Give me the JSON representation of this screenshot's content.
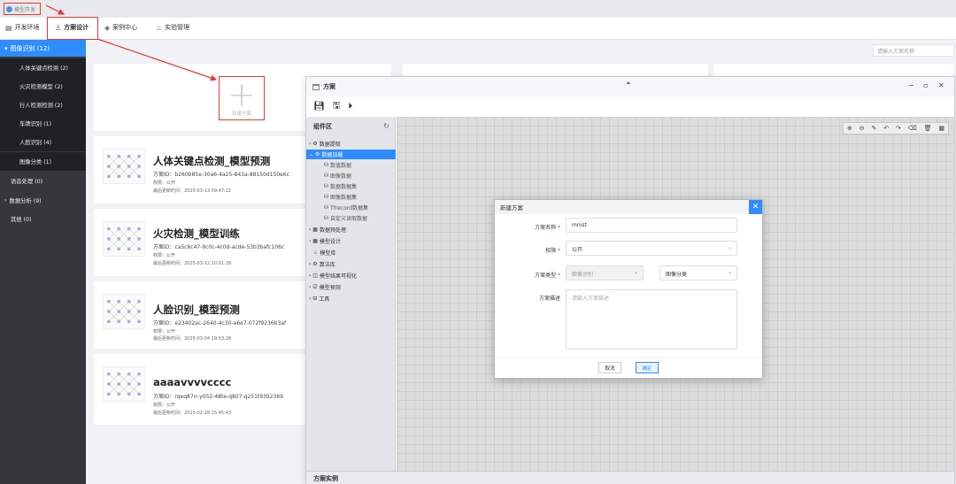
{
  "topbar": {
    "logo_text": "模型开发"
  },
  "nav": {
    "tabs": [
      {
        "label": "开发环境",
        "icon": "server-icon"
      },
      {
        "label": "方案设计",
        "icon": "user-icon",
        "active": true
      },
      {
        "label": "案例中心",
        "icon": "layers-icon"
      },
      {
        "label": "实验管理",
        "icon": "flask-icon"
      }
    ]
  },
  "sidebar": {
    "groups": [
      {
        "label": "图像识别 (12)",
        "expanded": true,
        "children": [
          "人体关键点检测 (2)",
          "火灾检测模型 (2)",
          "行人检测检测 (2)",
          "车牌识别 (1)",
          "人脸识别 (4)",
          "图像分类 (1)"
        ]
      },
      {
        "label": "语音处理 (0)"
      },
      {
        "label": "数据分析 (9)",
        "caret": true
      },
      {
        "label": "其他 (0)"
      }
    ]
  },
  "search": {
    "placeholder": "请输入方案名称"
  },
  "add_card": {
    "label": "新建方案"
  },
  "cards": [
    {
      "title": "人体关键点检测_模型预测",
      "id": "方案ID：b260b85e-30a6-4a25-843a-88150d150e6c",
      "perm": "权限：公开",
      "updated": "最后更新时间：2025-03-13 09:47:22"
    },
    {
      "title": "火灾检测_模型训练",
      "id": "方案ID：ca5c6c47-9c0c-4c0d-acde-53b3bafc106c",
      "perm": "权限：公开",
      "updated": "最后更新时间：2025-03-12 10:01:28"
    },
    {
      "title": "人脸识别_模型预测",
      "id": "方案ID：e23402ac-2640-4c30-a6e7-072f9236b3af",
      "perm": "权限：公开",
      "updated": "最后更新时间：2025-03-04 19:53:28"
    },
    {
      "title": "aaaavvvvcccc",
      "id": "方案ID：rqeq87rr-y052-48te-q807-q251t9392369",
      "perm": "权限：公开",
      "updated": "最后更新时间：2025-02-28 15:45:43"
    }
  ],
  "window": {
    "title": "方案",
    "panel_title": "组件区",
    "tree": [
      {
        "label": "数据提取",
        "level": 1
      },
      {
        "label": "数据加载",
        "level": 1,
        "selected": true
      },
      {
        "label": "数值数据",
        "level": 2
      },
      {
        "label": "图像数据",
        "level": 2
      },
      {
        "label": "数据数据集",
        "level": 2
      },
      {
        "label": "图像数据集",
        "level": 2
      },
      {
        "label": "Tfrecord数据集",
        "level": 2
      },
      {
        "label": "自定义读取数据",
        "level": 2
      },
      {
        "label": "数据预处理",
        "level": 1
      },
      {
        "label": "模型设计",
        "level": 1
      },
      {
        "label": "模型库",
        "level": 1
      },
      {
        "label": "算法库",
        "level": 1
      },
      {
        "label": "模型结果可视化",
        "level": 1
      },
      {
        "label": "模型预测",
        "level": 1
      },
      {
        "label": "工具",
        "level": 1
      }
    ],
    "footer": "方案实例"
  },
  "dialog": {
    "title": "新建方案",
    "name_label": "方案名称",
    "name_value": "mnist",
    "perm_label": "权限",
    "perm_value": "公开",
    "type_label": "方案类型",
    "type_value1": "图像识别",
    "type_value2": "图像分类",
    "desc_label": "方案描述",
    "desc_placeholder": "请输入方案描述",
    "cancel": "取消",
    "confirm": "确定"
  }
}
